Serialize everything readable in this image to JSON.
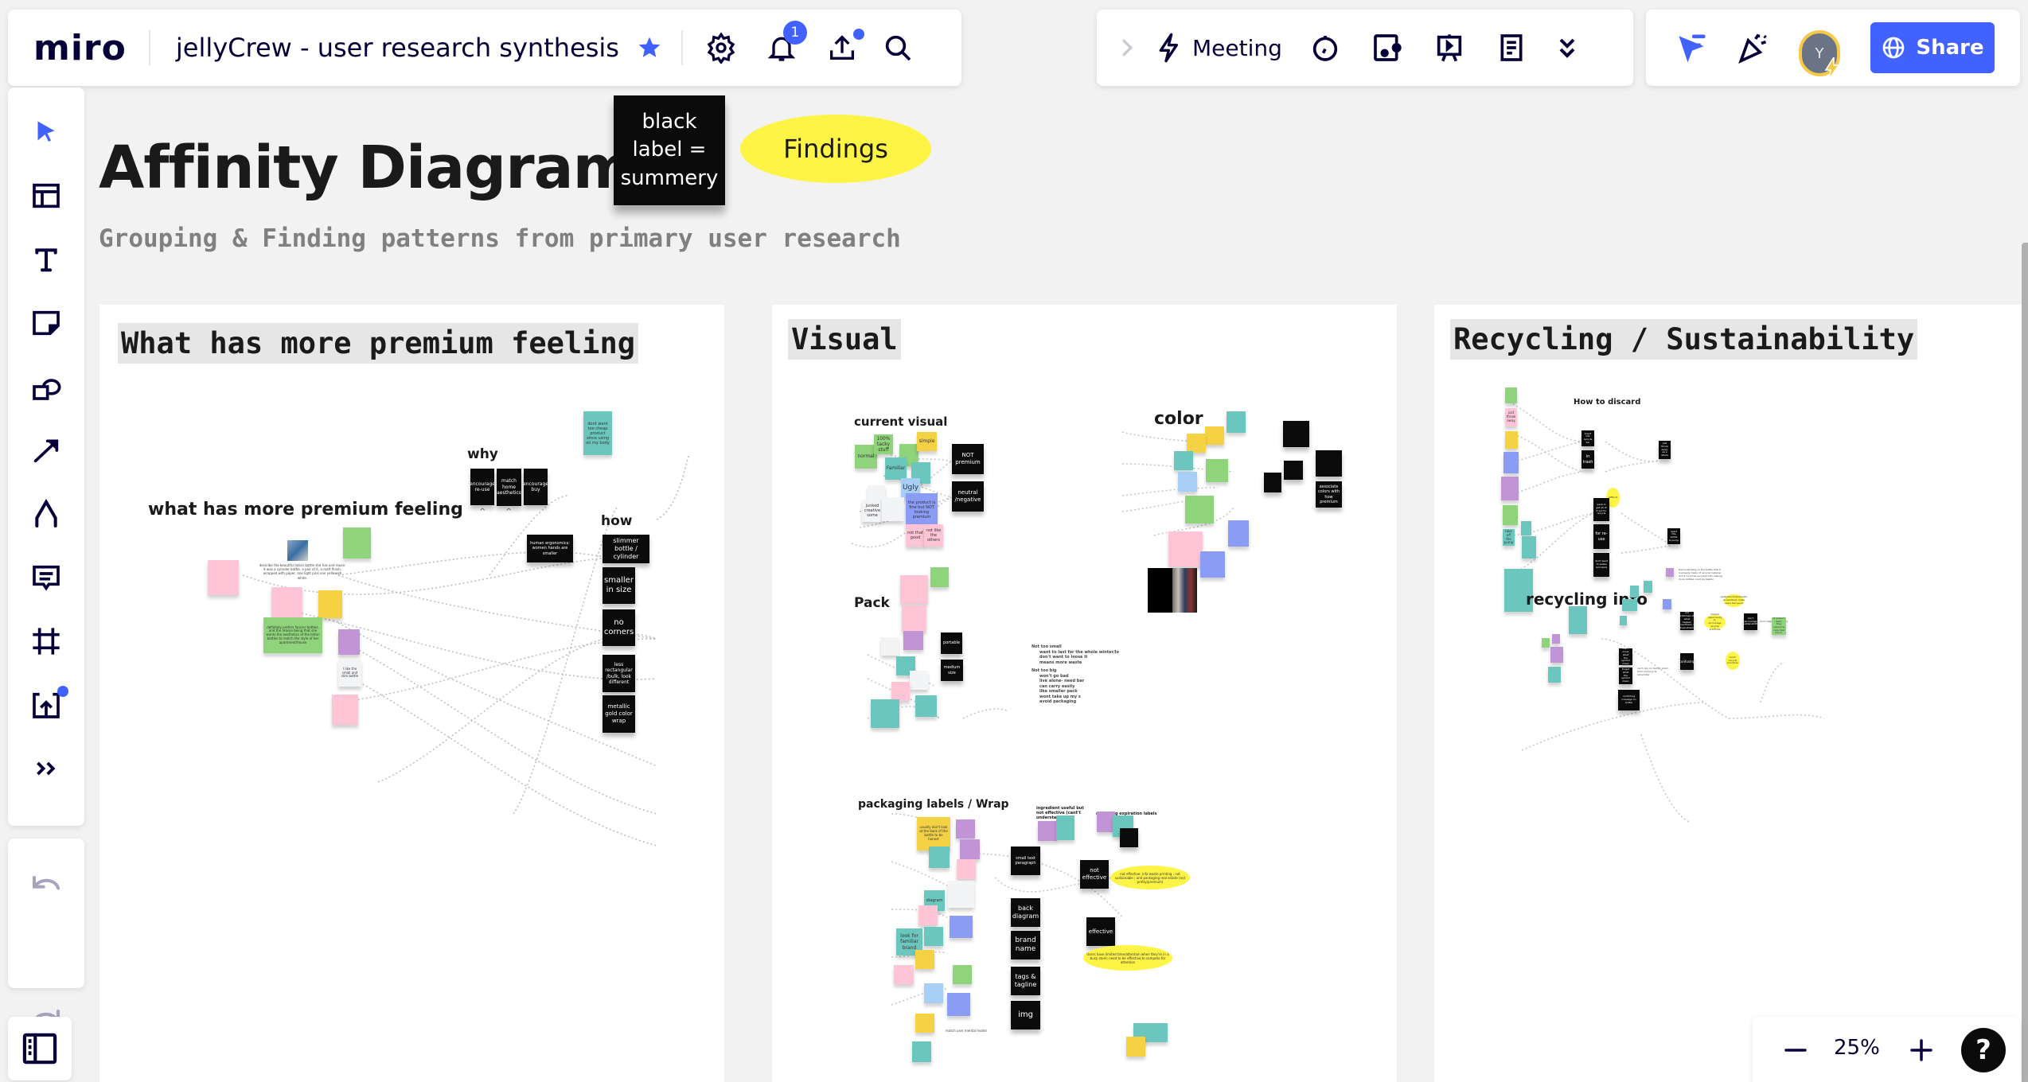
{
  "header": {
    "logo": "miro",
    "board_title": "jellyCrew - user research synthesis",
    "notification_count": "1",
    "icons": [
      "star-icon",
      "gear-icon",
      "bell-icon",
      "upload-icon",
      "search-icon"
    ]
  },
  "toolbar_center": {
    "collapse_icon": "chevron-right-icon",
    "meeting_label": "Meeting",
    "icons": [
      "lightning-icon",
      "timer-icon",
      "video-icon",
      "presentation-icon",
      "notes-icon",
      "chevrons-down-icon"
    ]
  },
  "toolbar_right": {
    "avatar_initial": "Y",
    "share_label": "Share",
    "icons": [
      "reactions-cursor-icon",
      "celebrate-icon",
      "globe-icon"
    ]
  },
  "left_tools": [
    {
      "name": "select",
      "icon": "cursor-icon",
      "active": true
    },
    {
      "name": "templates",
      "icon": "templates-icon"
    },
    {
      "name": "text",
      "icon": "text-icon"
    },
    {
      "name": "sticky-note",
      "icon": "sticky-note-icon"
    },
    {
      "name": "shapes",
      "icon": "shapes-icon"
    },
    {
      "name": "connection-line",
      "icon": "arrow-icon"
    },
    {
      "name": "pen",
      "icon": "pen-icon"
    },
    {
      "name": "comment",
      "icon": "comment-icon"
    },
    {
      "name": "frame",
      "icon": "frame-icon"
    },
    {
      "name": "upload",
      "icon": "upload-icon"
    },
    {
      "name": "more-tools",
      "icon": "double-chevron-right-icon"
    }
  ],
  "history": {
    "undo_icon": "undo-icon",
    "redo_icon": "redo-icon"
  },
  "zoom": {
    "level": "25%",
    "minus_icon": "minus-icon",
    "plus_icon": "plus-icon",
    "help_icon": "question-icon"
  },
  "board": {
    "title": "Affinity Diagram",
    "subtitle": "Grouping & Finding patterns from primary user research",
    "legend_black_label": "black label = summery",
    "legend_findings": "Findings",
    "frames": [
      {
        "title": "What has more premium feeling",
        "sections": {
          "main": "what has more premium feeling",
          "why": "why",
          "how": "how"
        },
        "summary_labels": {
          "why": [
            "encourage re-use",
            "match home aesthetics",
            "encourage buy"
          ],
          "human": "human ergonomics: women hands are smaller",
          "how": [
            "slimmer bottle / cylinder",
            "smaller in size",
            "no corners",
            "less rectangular /bulk, look different",
            "metallic gold color wrap"
          ]
        },
        "notes": {
          "teal_top": "dont want too cheap product since using on my body",
          "caption": "describe the beautiful lotion bottle she has and reuse: it was a cylinder bottle, a pair of it, a matt finish, wrapped with paper, one light pink one yellowish white.",
          "green_2": "definitely prefers fancier bottles, and the reason being that she wants the aesthetics of the lotion bottles to match the style of her apartment/house",
          "white_1": "I like the small and slim bottle"
        }
      },
      {
        "title": "Visual",
        "sections": {
          "current_visual": "current visual",
          "color": "color",
          "pack": "Pack",
          "packaging": "packaging labels / Wrap",
          "ingredient": "ingredient useful but not effective (cant't understand)",
          "expiration": "confusing expiration labels"
        },
        "current_visual_notes": [
          "normal",
          "100% tacky stuff",
          "simple",
          "Familiar",
          "Ugly",
          "junked creative some",
          "the product is fine but NOT looking premium",
          "not that good",
          "not like the others"
        ],
        "current_visual_labels": [
          "NOT premium",
          "neutral /negative"
        ],
        "color_labels": [
          "",
          "",
          "",
          "associate colors with how premium"
        ],
        "pack_labels": [
          "portable",
          "medium size"
        ],
        "pack_list": {
          "not_too_small_title": "Not too small",
          "not_too_small": [
            "want to last for the whole winter/lo",
            "don't want to loose it",
            "means more waste"
          ],
          "not_too_big_title": "Not too big",
          "not_too_big": [
            "won't go bad",
            "live alone- need bar",
            "can carry easily",
            "like smaller pack",
            "wont take up my s",
            "avoid packaging"
          ]
        },
        "packaging_labels": [
          "small text paragraph",
          "back diagram",
          "brand name",
          "tags & tagline",
          "img",
          "not effective",
          "effective"
        ],
        "packaging_notes": [
          "usually don't look at the back of the bottle to be honest",
          "diagram",
          "look for familiar brand"
        ],
        "packaging_findings": [
          "not effective: info waste printing ; not sustainable ; and packaging real estate (not pretty/premium)",
          "Users have limited time/attention when they're in a busy store; need to be effective to compete for attention"
        ],
        "mental_model_note": "match user mental model"
      },
      {
        "title": "Recycling / Sustainability",
        "sections": {
          "discard": "How to discard",
          "info": "recycling info"
        },
        "discard_notes": [
          "just throw away",
          "take off the pump"
        ],
        "discard_labels": [
          "insert into recycle bin",
          "in trash",
          "just throw away as a whole",
          "want to get all of it out for recycle",
          "for re-use",
          "apart the bottle & pump",
          "don't want to waste remnants"
        ],
        "discard_finding": "difficult",
        "info_labels": [
          "not informed of what happen upstream / downstream",
          "don't encourage sustainability",
          "don't know what the symbol mean",
          "confusing",
          "forgot what the symbol mean",
          "conflicting message on bottle"
        ],
        "info_findings": [
          "missed opportunity to encourage recycle practices",
          "upstream/downstream as feedback make users feel good",
          "block recycle practices"
        ],
        "info_texts": [
          "Demonstrating on the bottle that it is already made of recycle material and it could be recycled into making more bottles could be helpful",
          "can't rely on human short-term-memory to remember",
          "don't help brand image"
        ],
        "info_note_right": "It doesn't seem they (user/me) care that much."
      }
    ]
  },
  "colors": {
    "accent": "#4262ff",
    "ink": "#050038",
    "sticky_yellow": "#f5d243",
    "sticky_green": "#8fd37a",
    "sticky_pink": "#ffc4d6",
    "sticky_teal": "#6bc7bd",
    "sticky_violet": "#c194d6",
    "sticky_blue": "#8a9cf5",
    "finding_yellow": "#fef445"
  }
}
